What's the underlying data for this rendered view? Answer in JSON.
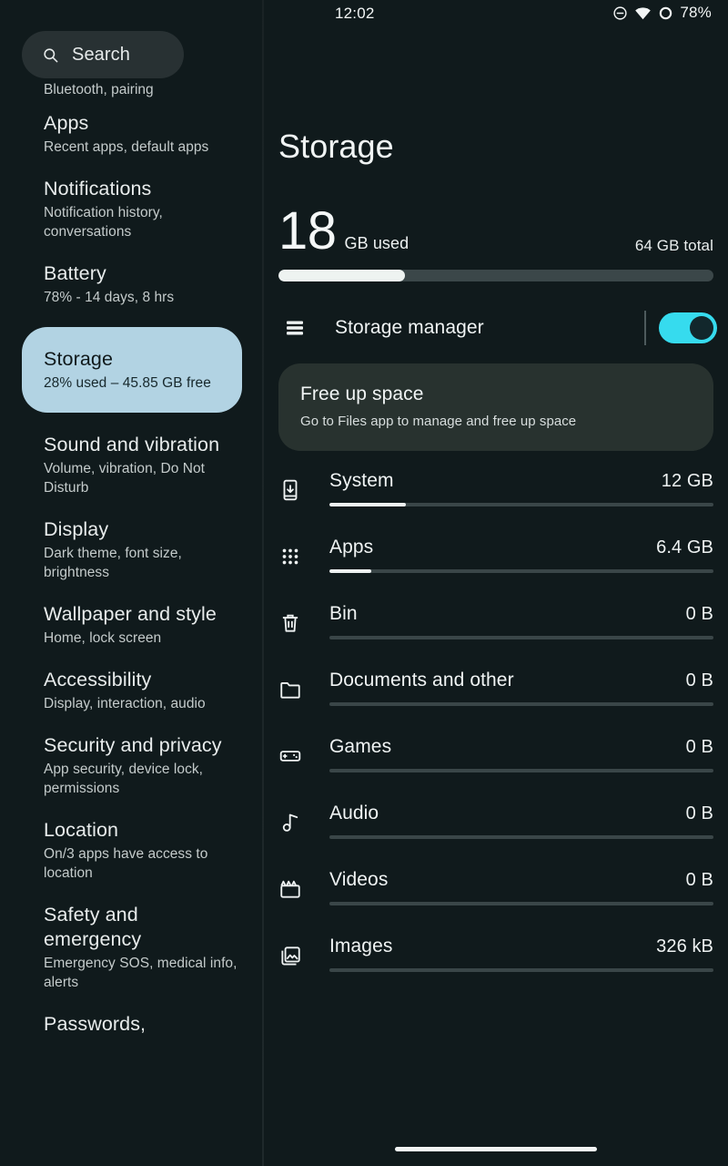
{
  "statusbar": {
    "time": "12:02",
    "battery_percent": "78%",
    "icons": [
      "do-not-disturb-icon",
      "wifi-icon",
      "battery-icon"
    ]
  },
  "sidebar": {
    "search": {
      "placeholder": "Search",
      "icon": "search-icon"
    },
    "orphan_subtitle": "Bluetooth, pairing",
    "items": [
      {
        "title": "Apps",
        "subtitle": "Recent apps, default apps",
        "selected": false
      },
      {
        "title": "Notifications",
        "subtitle": "Notification history, conversations",
        "selected": false
      },
      {
        "title": "Battery",
        "subtitle": "78% - 14 days, 8 hrs",
        "selected": false
      },
      {
        "title": "Storage",
        "subtitle": "28% used – 45.85 GB free",
        "selected": true
      },
      {
        "title": "Sound and vibration",
        "subtitle": "Volume, vibration, Do Not Disturb",
        "selected": false
      },
      {
        "title": "Display",
        "subtitle": "Dark theme, font size, brightness",
        "selected": false
      },
      {
        "title": "Wallpaper and style",
        "subtitle": "Home, lock screen",
        "selected": false
      },
      {
        "title": "Accessibility",
        "subtitle": "Display, interaction, audio",
        "selected": false
      },
      {
        "title": "Security and privacy",
        "subtitle": "App security, device lock, permissions",
        "selected": false
      },
      {
        "title": "Location",
        "subtitle": "On/3 apps have access to location",
        "selected": false
      },
      {
        "title": "Safety and emergency",
        "subtitle": "Emergency SOS, medical info, alerts",
        "selected": false
      },
      {
        "title": "Passwords,",
        "subtitle": "",
        "selected": false
      }
    ]
  },
  "main": {
    "page_title": "Storage",
    "summary": {
      "used_value": "18",
      "used_unit": "GB used",
      "total_label": "64 GB total",
      "used_fraction_percent": 29
    },
    "storage_manager": {
      "label": "Storage manager",
      "icon": "storage-bars-icon",
      "toggle_on": true
    },
    "free_up_space": {
      "title": "Free up space",
      "subtitle": "Go to Files app to manage and free up space"
    },
    "categories": [
      {
        "name": "System",
        "size": "12 GB",
        "icon": "phone-download-icon",
        "bar_percent": 20
      },
      {
        "name": "Apps",
        "size": "6.4 GB",
        "icon": "apps-grid-icon",
        "bar_percent": 11
      },
      {
        "name": "Bin",
        "size": "0 B",
        "icon": "trash-icon",
        "bar_percent": 0
      },
      {
        "name": "Documents and other",
        "size": "0 B",
        "icon": "folder-icon",
        "bar_percent": 0
      },
      {
        "name": "Games",
        "size": "0 B",
        "icon": "gamepad-icon",
        "bar_percent": 0
      },
      {
        "name": "Audio",
        "size": "0 B",
        "icon": "music-note-icon",
        "bar_percent": 0
      },
      {
        "name": "Videos",
        "size": "0 B",
        "icon": "clapperboard-icon",
        "bar_percent": 0
      },
      {
        "name": "Images",
        "size": "326 kB",
        "icon": "image-icon",
        "bar_percent": 0
      }
    ]
  },
  "colors": {
    "background": "#101a1c",
    "selected_item": "#b2d3e3",
    "toggle_on": "#36dbee",
    "card": "#28322f",
    "bar_track": "#3a4648",
    "bar_fill": "#eef2f2"
  }
}
